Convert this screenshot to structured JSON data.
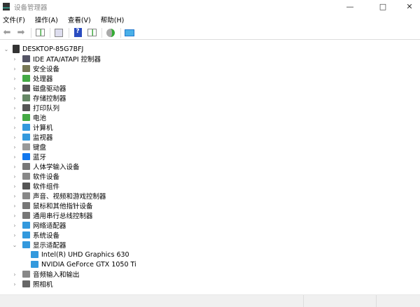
{
  "window": {
    "title": "设备管理器"
  },
  "menu": [
    "文件(F)",
    "操作(A)",
    "查看(V)",
    "帮助(H)"
  ],
  "toolbar": [
    "back-icon",
    "forward-icon",
    "properties-icon",
    "update-list-icon",
    "help-icon",
    "show-hidden-icon",
    "scan-hardware-icon",
    "monitor-icon"
  ],
  "tree": {
    "root": "DESKTOP-85G7BFJ",
    "categories": [
      {
        "label": "IDE ATA/ATAPI 控制器",
        "color": "#556"
      },
      {
        "label": "安全设备",
        "color": "#775"
      },
      {
        "label": "处理器",
        "color": "#4a4"
      },
      {
        "label": "磁盘驱动器",
        "color": "#555"
      },
      {
        "label": "存储控制器",
        "color": "#686"
      },
      {
        "label": "打印队列",
        "color": "#555"
      },
      {
        "label": "电池",
        "color": "#4a4"
      },
      {
        "label": "计算机",
        "color": "#39d"
      },
      {
        "label": "监视器",
        "color": "#39d"
      },
      {
        "label": "键盘",
        "color": "#999"
      },
      {
        "label": "蓝牙",
        "color": "#17e"
      },
      {
        "label": "人体学输入设备",
        "color": "#777"
      },
      {
        "label": "软件设备",
        "color": "#888"
      },
      {
        "label": "软件组件",
        "color": "#555"
      },
      {
        "label": "声音、视频和游戏控制器",
        "color": "#888"
      },
      {
        "label": "鼠标和其他指针设备",
        "color": "#777"
      },
      {
        "label": "通用串行总线控制器",
        "color": "#777"
      },
      {
        "label": "网络适配器",
        "color": "#39d"
      },
      {
        "label": "系统设备",
        "color": "#39d"
      },
      {
        "label": "显示适配器",
        "color": "#39d",
        "expanded": true,
        "children": [
          "Intel(R) UHD Graphics 630",
          "NVIDIA GeForce GTX 1050 Ti"
        ]
      },
      {
        "label": "音频输入和输出",
        "color": "#888"
      },
      {
        "label": "照相机",
        "color": "#666"
      }
    ]
  }
}
